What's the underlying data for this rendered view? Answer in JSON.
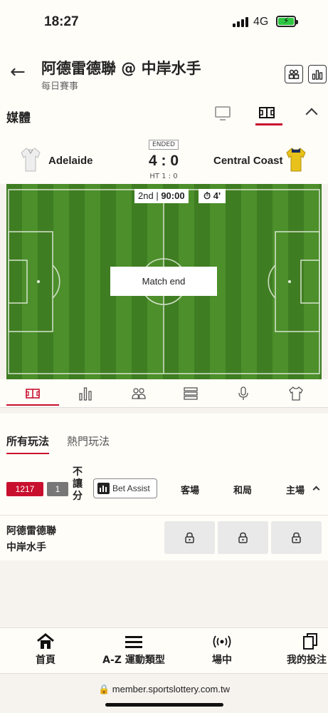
{
  "status": {
    "time": "18:27",
    "network": "4G"
  },
  "header": {
    "title": "阿德雷德聯 @ 中岸水手",
    "subtitle": "每日賽事"
  },
  "media": {
    "label": "媒體"
  },
  "match": {
    "home_team": "Adelaide",
    "away_team": "Central Coast",
    "status_badge": "ENDED",
    "score": "4 : 0",
    "halftime": "HT 1 : 0",
    "period": "2nd",
    "clock": "90:00",
    "added_time": "4'",
    "overlay": "Match end"
  },
  "panel": {
    "tabs": [
      "所有玩法",
      "熱門玩法"
    ],
    "event_id": "1217",
    "count": "1",
    "market_label": [
      "不",
      "讓",
      "分"
    ],
    "bet_assist": "Bet Assist",
    "columns": [
      "客場",
      "和局",
      "主場"
    ],
    "team_line1": "阿德雷德聯",
    "team_line2": "中岸水手"
  },
  "nav": [
    "首頁",
    "A-Z 運動類型",
    "場中",
    "我的投注"
  ],
  "url": "member.sportslottery.com.tw",
  "colors": {
    "accent": "#c8102e",
    "pitch_dark": "#3f7d22",
    "pitch_light": "#4c8f2b",
    "battery": "#2ec742"
  }
}
